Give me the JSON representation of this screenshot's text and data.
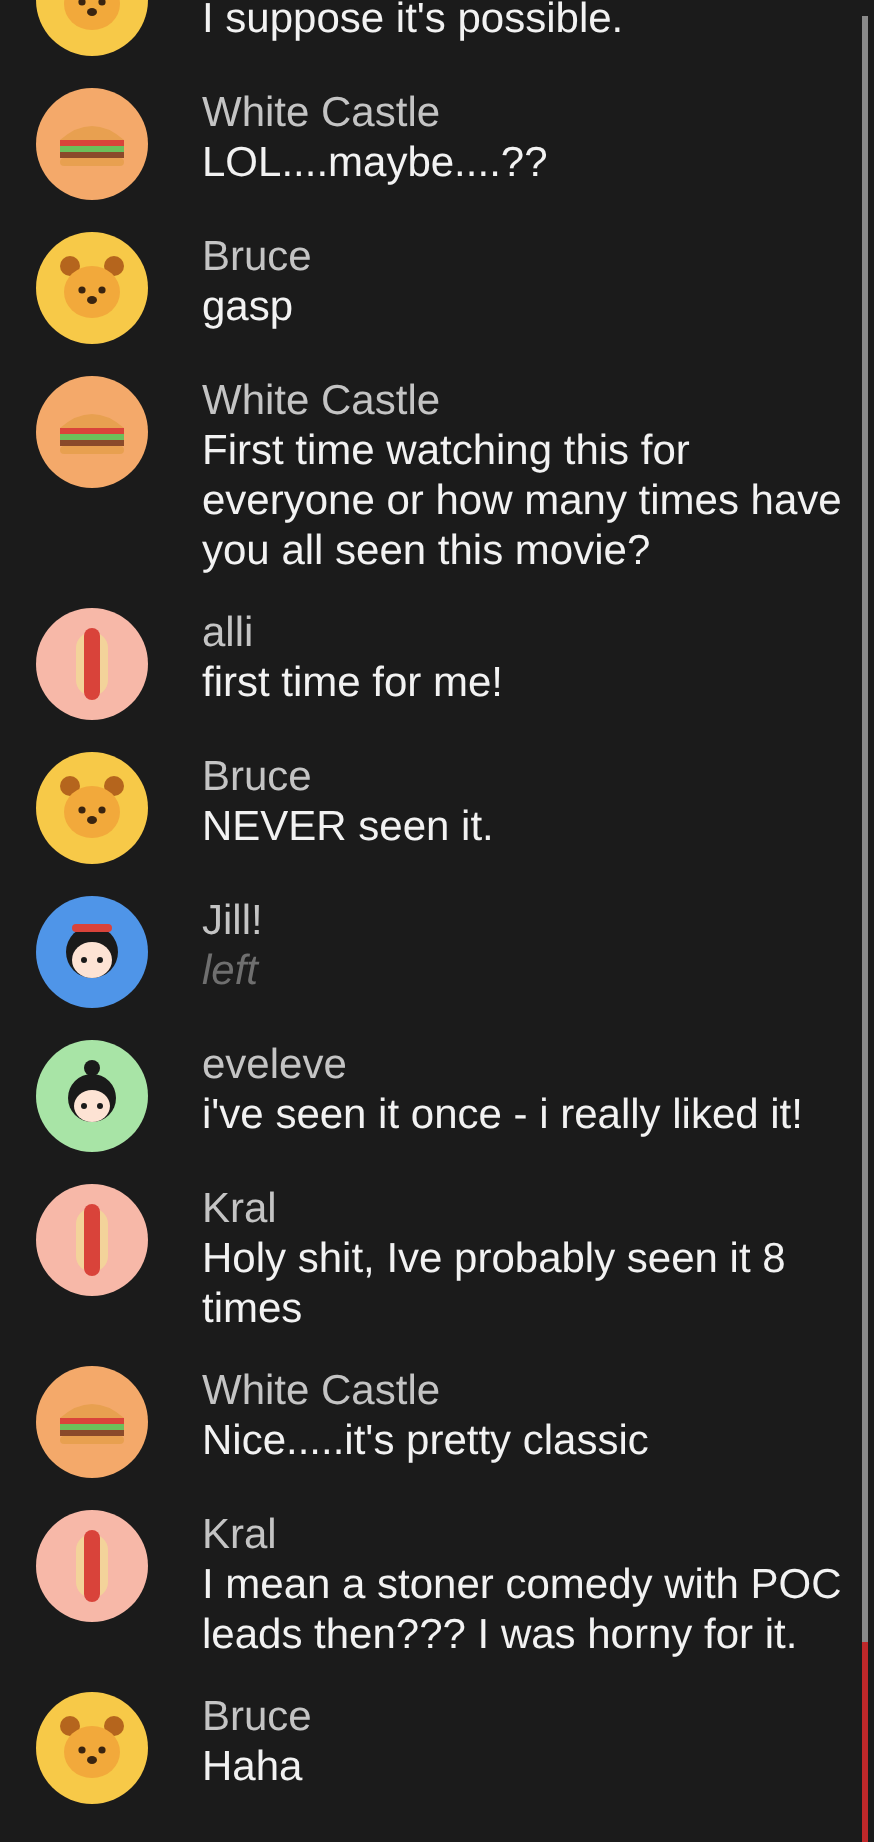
{
  "messages": [
    {
      "kind": "partial",
      "avatar": {
        "kind": "bear"
      },
      "text": "I suppose it's possible."
    },
    {
      "kind": "text",
      "avatar": {
        "kind": "burger"
      },
      "author": "White Castle",
      "text": "LOL....maybe....??"
    },
    {
      "kind": "text",
      "avatar": {
        "kind": "bear"
      },
      "author": "Bruce",
      "text": "gasp"
    },
    {
      "kind": "text",
      "avatar": {
        "kind": "burger"
      },
      "author": "White Castle",
      "text": "First time watching this for everyone or how many times have you all seen this movie?"
    },
    {
      "kind": "text",
      "avatar": {
        "kind": "hotdog"
      },
      "author": "alli",
      "text": "first time for me!"
    },
    {
      "kind": "text",
      "avatar": {
        "kind": "bear"
      },
      "author": "Bruce",
      "text": "NEVER seen it."
    },
    {
      "kind": "status",
      "avatar": {
        "kind": "girl-blue"
      },
      "author": "Jill!",
      "text": "left"
    },
    {
      "kind": "text",
      "avatar": {
        "kind": "girl-green"
      },
      "author": "eveleve",
      "text": "i've seen it once - i really liked it!"
    },
    {
      "kind": "text",
      "avatar": {
        "kind": "hotdog"
      },
      "author": "Kral",
      "text": "Holy shit, Ive probably seen it 8 times"
    },
    {
      "kind": "text",
      "avatar": {
        "kind": "burger"
      },
      "author": "White Castle",
      "text": "Nice.....it's pretty classic"
    },
    {
      "kind": "text",
      "avatar": {
        "kind": "hotdog"
      },
      "author": "Kral",
      "text": "I mean a stoner comedy with POC leads then??? I was horny for it."
    },
    {
      "kind": "text",
      "avatar": {
        "kind": "bear"
      },
      "author": "Bruce",
      "text": "Haha"
    }
  ]
}
